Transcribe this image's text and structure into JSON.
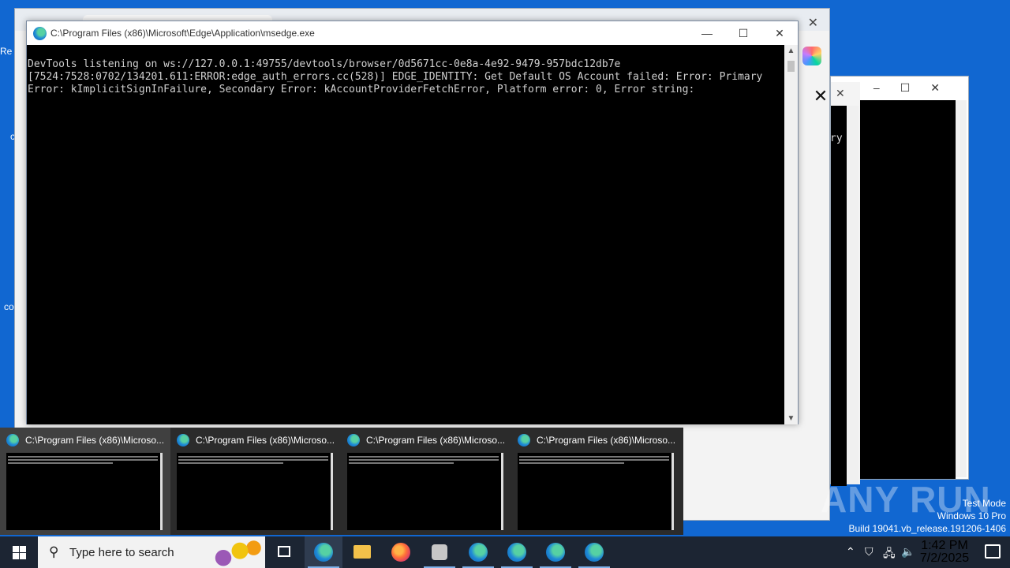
{
  "desktop": {
    "left_fragments": [
      "Re",
      "c",
      "co"
    ]
  },
  "console_window": {
    "title": "C:\\Program Files (x86)\\Microsoft\\Edge\\Application\\msedge.exe",
    "lines": [
      "DevTools listening on ws://127.0.0.1:49755/devtools/browser/0d5671cc-0e8a-4e92-9479-957bdc12db7e",
      "[7524:7528:0702/134201.611:ERROR:edge_auth_errors.cc(528)] EDGE_IDENTITY: Get Default OS Account failed: Error: Primary",
      "Error: kImplicitSignInFailure, Secondary Error: kAccountProviderFetchError, Platform error: 0, Error string:"
    ],
    "minimize_glyph": "—",
    "maximize_glyph": "☐",
    "close_glyph": "✕"
  },
  "mid_window": {
    "text_fragment": "ry"
  },
  "thumbnails": [
    {
      "label": "C:\\Program Files (x86)\\Microso..."
    },
    {
      "label": "C:\\Program Files (x86)\\Microso..."
    },
    {
      "label": "C:\\Program Files (x86)\\Microso..."
    },
    {
      "label": "C:\\Program Files (x86)\\Microso..."
    }
  ],
  "watermark": {
    "brand": "ANY RUN",
    "test_mode": "Test Mode",
    "edition": "Windows 10 Pro",
    "build": "Build 19041.vb_release.191206-1406"
  },
  "taskbar": {
    "search_placeholder": "Type here to search",
    "time": "1:42 PM",
    "date": "7/2/2025",
    "icons": [
      "taskview-icon",
      "edge-icon",
      "file-explorer-icon",
      "firefox-icon",
      "app-icon",
      "edge-icon",
      "edge-icon",
      "edge-icon",
      "edge-icon"
    ]
  }
}
